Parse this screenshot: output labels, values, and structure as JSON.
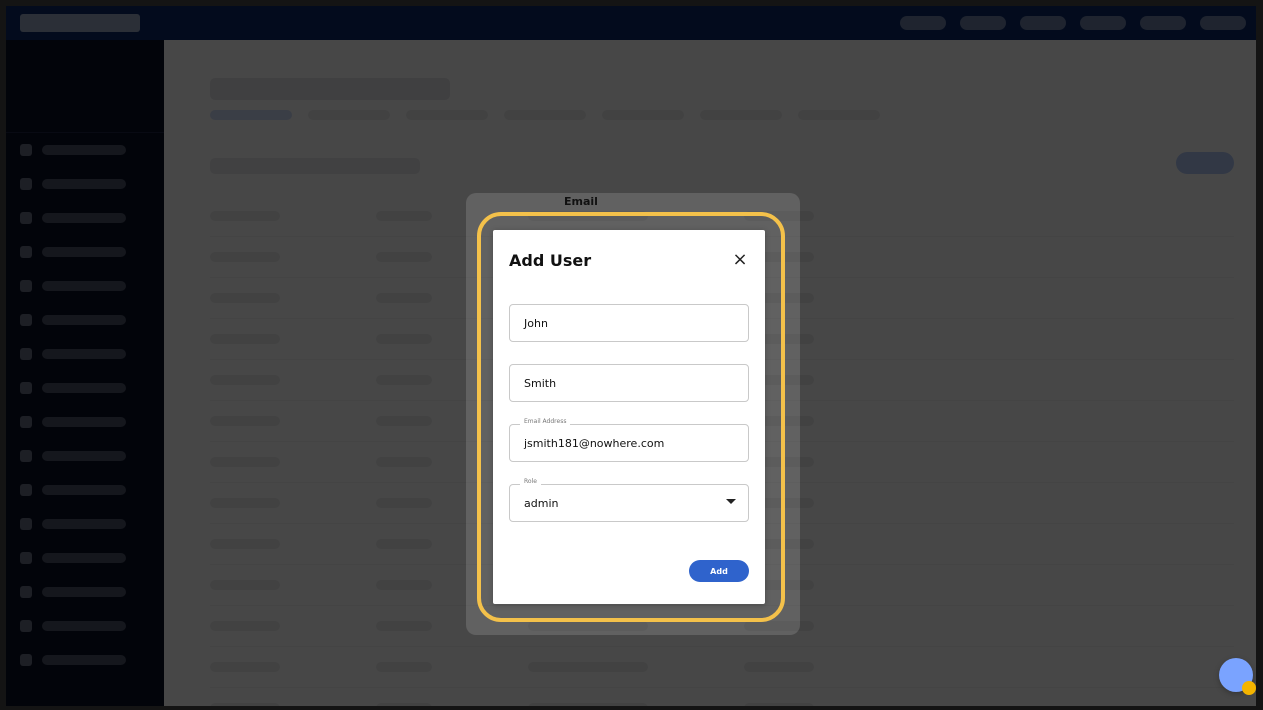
{
  "table": {
    "email_header": "Email"
  },
  "modal": {
    "title": "Add User",
    "first_name_value": "John",
    "last_name_value": "Smith",
    "email_label": "Email Address",
    "email_value": "jsmith181@nowhere.com",
    "role_label": "Role",
    "role_value": "admin",
    "add_label": "Add"
  },
  "icons": {
    "close": "×"
  },
  "colors": {
    "topbar": "#0b2a6a",
    "sidebar": "#0a0f24",
    "highlight": "#f4c14a",
    "primary_button": "#2f63cc"
  }
}
